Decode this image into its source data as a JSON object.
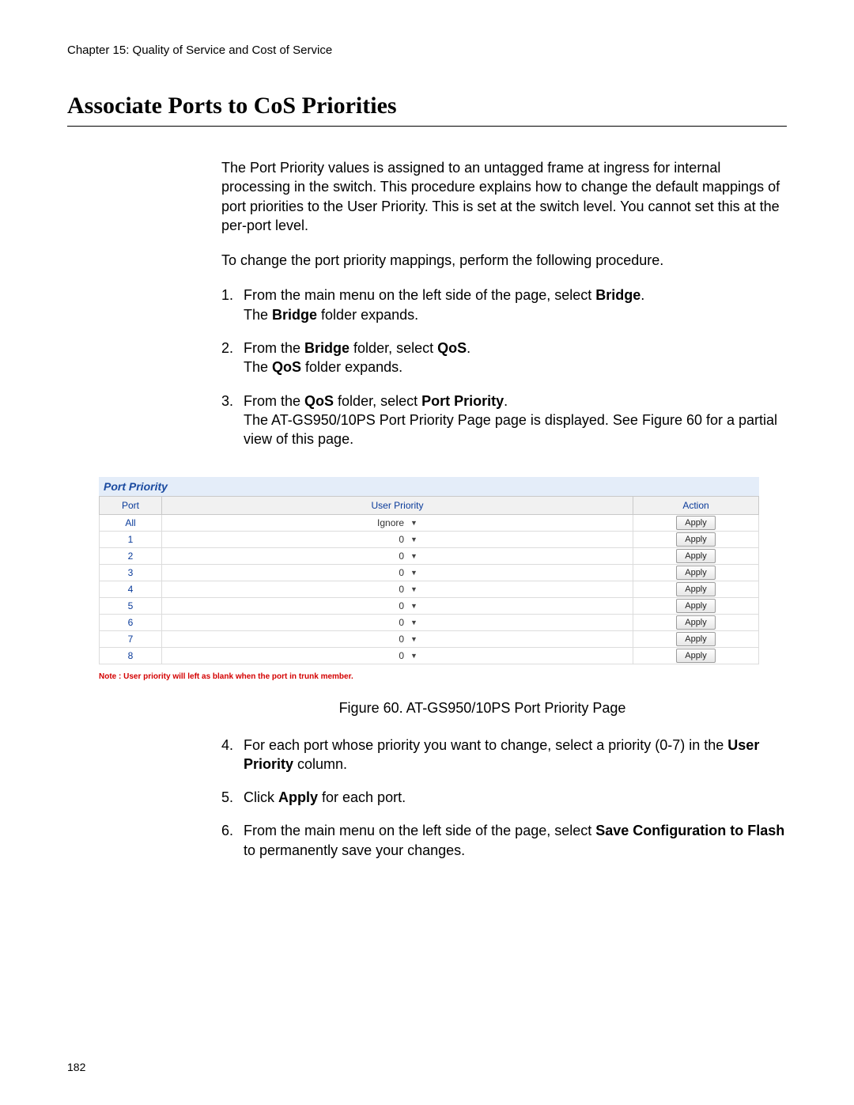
{
  "chapter_header": "Chapter 15: Quality of Service and Cost of Service",
  "section_title": "Associate Ports to CoS Priorities",
  "intro_paragraph": "The Port Priority values is assigned to an untagged frame at ingress for internal processing in the switch. This procedure explains how to change the default mappings of port priorities to the User Priority. This is set at the switch level. You cannot set this at the per-port level.",
  "procedure_intro": "To change the port priority mappings, perform the following procedure.",
  "steps_top": [
    {
      "num": "1.",
      "lines": [
        {
          "t": "From the main menu on the left side of the page, select ",
          "b": "Bridge",
          "suffix": "."
        },
        {
          "t": "The ",
          "b": "Bridge",
          "suffix": " folder expands."
        }
      ]
    },
    {
      "num": "2.",
      "lines": [
        {
          "t": "From the ",
          "b": "Bridge",
          "suffix": " folder, select ",
          "b2": "QoS",
          "suffix2": "."
        },
        {
          "t": "The ",
          "b": "QoS",
          "suffix": " folder expands."
        }
      ]
    },
    {
      "num": "3.",
      "lines": [
        {
          "t": "From the ",
          "b": "QoS",
          "suffix": " folder, select ",
          "b2": "Port Priority",
          "suffix2": "."
        },
        {
          "t": "The AT-GS950/10PS Port Priority Page page is displayed. See Figure 60 for a partial view of this page."
        }
      ]
    }
  ],
  "port_priority": {
    "title": "Port Priority",
    "headers": {
      "port": "Port",
      "user_priority": "User Priority",
      "action": "Action"
    },
    "apply_label": "Apply",
    "rows": [
      {
        "port": "All",
        "priority": "Ignore"
      },
      {
        "port": "1",
        "priority": "0"
      },
      {
        "port": "2",
        "priority": "0"
      },
      {
        "port": "3",
        "priority": "0"
      },
      {
        "port": "4",
        "priority": "0"
      },
      {
        "port": "5",
        "priority": "0"
      },
      {
        "port": "6",
        "priority": "0"
      },
      {
        "port": "7",
        "priority": "0"
      },
      {
        "port": "8",
        "priority": "0"
      }
    ],
    "note": "Note : User priority will left as blank when the port in trunk member."
  },
  "figure_caption": "Figure 60. AT-GS950/10PS Port Priority Page",
  "steps_bottom": [
    {
      "num": "4.",
      "lines": [
        {
          "t": "For each port whose priority you want to change, select a priority (0-7) in the ",
          "b": "User Priority",
          "suffix": " column."
        }
      ]
    },
    {
      "num": "5.",
      "lines": [
        {
          "t": "Click ",
          "b": "Apply",
          "suffix": " for each port."
        }
      ]
    },
    {
      "num": "6.",
      "lines": [
        {
          "t": "From the main menu on the left side of the page, select ",
          "b": "Save Configuration to Flash",
          "suffix": " to permanently save your changes."
        }
      ]
    }
  ],
  "page_number": "182"
}
